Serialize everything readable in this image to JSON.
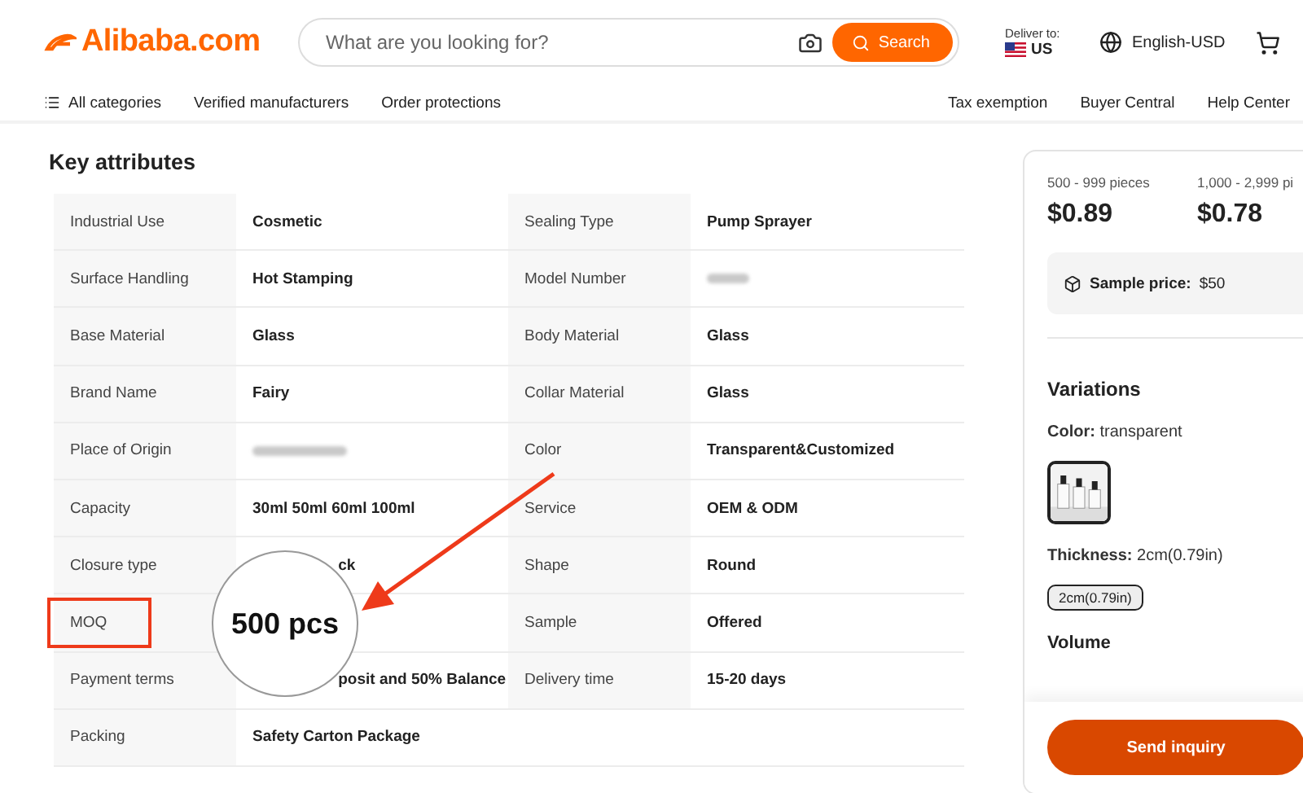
{
  "header": {
    "logo": "Alibaba.com",
    "search": {
      "placeholder": "What are you looking for?",
      "button": "Search"
    },
    "deliver_label": "Deliver to:",
    "deliver_country": "US",
    "language": "English-USD"
  },
  "nav": {
    "left": [
      "All categories",
      "Verified manufacturers",
      "Order protections"
    ],
    "right": [
      "Tax exemption",
      "Buyer Central",
      "Help Center"
    ]
  },
  "attributes": {
    "title": "Key attributes",
    "rows": [
      {
        "left": {
          "label": "Industrial Use",
          "value": "Cosmetic"
        },
        "right": {
          "label": "Sealing Type",
          "value": "Pump Sprayer"
        }
      },
      {
        "left": {
          "label": "Surface Handling",
          "value": "Hot Stamping"
        },
        "right": {
          "label": "Model Number",
          "redacted": true
        }
      },
      {
        "left": {
          "label": "Base Material",
          "value": "Glass"
        },
        "right": {
          "label": "Body Material",
          "value": "Glass"
        }
      },
      {
        "left": {
          "label": "Brand Name",
          "value": "Fairy"
        },
        "right": {
          "label": "Collar Material",
          "value": "Glass"
        }
      },
      {
        "left": {
          "label": "Place of Origin",
          "redacted": true
        },
        "right": {
          "label": "Color",
          "value": "Transparent&Customized"
        }
      },
      {
        "left": {
          "label": "Capacity",
          "value": "30ml 50ml 60ml 100ml"
        },
        "right": {
          "label": "Service",
          "value": "OEM & ODM"
        }
      },
      {
        "left": {
          "label": "Closure type",
          "value": "ck",
          "covered": true
        },
        "right": {
          "label": "Shape",
          "value": "Round"
        }
      },
      {
        "left": {
          "label": "MOQ",
          "highlighted": true
        },
        "right": {
          "label": "Sample",
          "value": "Offered"
        }
      },
      {
        "left": {
          "label": "Payment terms",
          "value": "posit and 50% Balance",
          "covered": true
        },
        "right": {
          "label": "Delivery time",
          "value": "15-20 days"
        }
      },
      {
        "left": {
          "label": "Packing",
          "value": "Safety Carton Package"
        }
      }
    ],
    "magnifier": "500 pcs"
  },
  "pricing": {
    "tiers": [
      {
        "range": "500 - 999 pieces",
        "price": "$0.89"
      },
      {
        "range": "1,000 - 2,999 pi",
        "price": "$0.78"
      }
    ],
    "sample_label": "Sample price:",
    "sample_value": "$50"
  },
  "variations": {
    "title": "Variations",
    "color_label": "Color:",
    "color_value": "transparent",
    "swatches": [
      {
        "kind": "picture",
        "selected": true
      }
    ],
    "thickness_label": "Thickness:",
    "thickness_value": "2cm(0.79in)",
    "thickness_options": [
      {
        "label": "2cm(0.79in)",
        "selected": true
      }
    ],
    "volume_title": "Volume"
  },
  "inquiry_button": "Send inquiry"
}
